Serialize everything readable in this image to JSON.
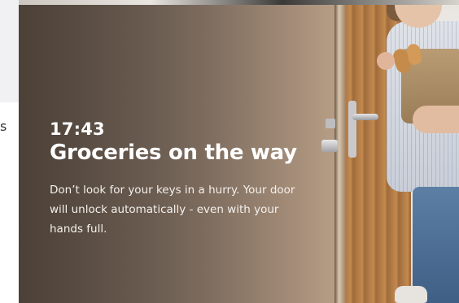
{
  "left_panel": {
    "fragment_text": "s"
  },
  "hero": {
    "time": "17:43",
    "title": "Groceries on the way",
    "description": "Don’t look for your keys in a hurry. Your door will unlock automatically - even with your hands full.",
    "image_subject": "woman-carrying-groceries-at-door"
  },
  "colors": {
    "text_primary": "#ffffff",
    "left_panel_bg": "#f1f1f3",
    "door_wood": "#b07a45"
  }
}
